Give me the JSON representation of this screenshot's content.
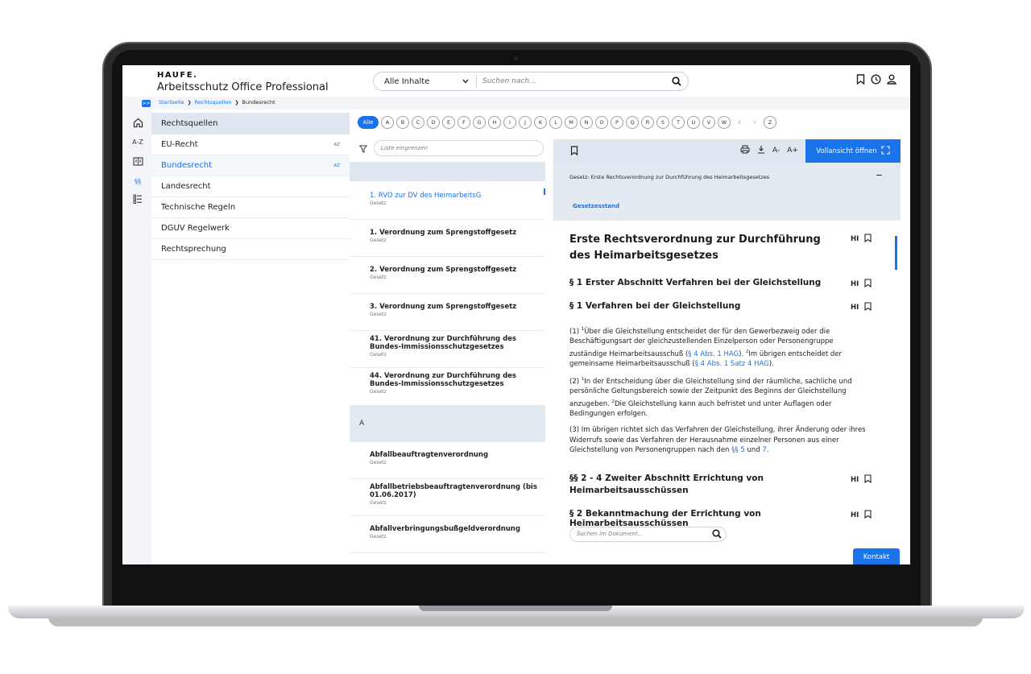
{
  "header": {
    "logo": "HAUFE.",
    "app_title": "Arbeitsschutz Office Professional",
    "scope": "Alle Inhalte",
    "search_placeholder": "Suchen nach..."
  },
  "breadcrumb": {
    "collapse_label": ">>",
    "items": [
      "Startseite",
      "Rechtsquellen",
      "Bundesrecht"
    ]
  },
  "rail": {
    "items": [
      {
        "icon": "home-icon"
      },
      {
        "label": "A-Z"
      },
      {
        "icon": "book-icon"
      },
      {
        "label": "§§"
      },
      {
        "icon": "list-icon"
      }
    ]
  },
  "sources": {
    "heading": "Rechtsquellen",
    "items": [
      {
        "label": "EU-Recht",
        "az": "AZ"
      },
      {
        "label": "Bundesrecht",
        "az": "AZ"
      },
      {
        "label": "Landesrecht",
        "az": ""
      },
      {
        "label": "Technische Regeln",
        "az": ""
      },
      {
        "label": "DGUV Regelwerk",
        "az": ""
      },
      {
        "label": "Rechtsprechung",
        "az": ""
      }
    ],
    "active_index": 1
  },
  "letters": {
    "all": "Alle",
    "items": [
      "A",
      "B",
      "C",
      "D",
      "E",
      "F",
      "G",
      "H",
      "I",
      "J",
      "K",
      "L",
      "M",
      "N",
      "O",
      "P",
      "Q",
      "R",
      "S",
      "T",
      "U",
      "V",
      "W",
      "X",
      "Y",
      "Z"
    ],
    "disabled": [
      "X",
      "Y"
    ]
  },
  "list": {
    "filter_placeholder": "Liste eingrenzen",
    "items": [
      {
        "title": "1. RVO zur DV des HeimarbeitsG",
        "type": "Gesetz"
      },
      {
        "title": "1. Verordnung zum Sprengstoffgesetz",
        "type": "Gesetz"
      },
      {
        "title": "2. Verordnung zum Sprengstoffgesetz",
        "type": "Gesetz"
      },
      {
        "title": "3. Verordnung zum Sprengstoffgesetz",
        "type": "Gesetz"
      },
      {
        "title": "41. Verordnung zur Durchführung des Bundes-Immissionsschutzgesetzes",
        "type": "Gesetz"
      },
      {
        "title": "44. Verordnung zur Durchführung des Bundes-Immissionsschutzgesetzes",
        "type": "Gesetz"
      },
      {
        "title": "Abfallbeauftragtenverordnung",
        "type": "Gesetz"
      },
      {
        "title": "Abfallbetriebsbeauftragtenverordnung (bis 01.06.2017)",
        "type": "Gesetz"
      },
      {
        "title": "Abfallverbringungsbußgeldverordnung",
        "type": "Gesetz"
      }
    ],
    "section_letter": "A"
  },
  "doc": {
    "toolbar": {
      "font_smaller": "A-",
      "font_larger": "A+",
      "fullview": "Vollansicht öffnen"
    },
    "law_title": "Gesetz: Erste Rechtsverordnung zur Durchführung des Heimarbeitsgesetzes",
    "law_collapse": "−",
    "law_status": "Gesetzesstand",
    "title": "Erste Rechtsverordnung zur Durchführung des Heimarbeitsgesetzes",
    "hl_label": "HI",
    "section1": "§ 1 Erster Abschnitt Verfahren bei der Gleichstellung",
    "section1b": "§ 1 Verfahren bei der Gleichstellung",
    "p1": {
      "a": "(1) ",
      "sup1": "1",
      "b": "Über die Gleichstellung entscheidet der für den Gewerbezweig oder die Beschäftigungsart der gleichzustellenden Einzelperson oder Personengruppe zuständige Heimarbeitsausschuß (",
      "link1": "§ 4 Abs. 1 HAG",
      "c": "). ",
      "sup2": "2",
      "d": "Im übrigen entscheidet der gemeinsame Heimarbeitsausschuß (",
      "link2": "§ 4 Abs. 1 Satz 4 HAG",
      "e": ")."
    },
    "p2": {
      "a": "(2) ",
      "sup1": "1",
      "b": "In der Entscheidung über die Gleichstellung sind der räumliche, sachliche und persönliche Geltungsbereich sowie der Zeitpunkt des Beginns der Gleichstellung anzugeben. ",
      "sup2": "2",
      "c": "Die Gleichstellung kann auch befristet und unter Auflagen oder Bedingungen erfolgen."
    },
    "p3": {
      "a": "(3) Im übrigen richtet sich das Verfahren der Gleichstellung, ihrer Änderung oder ihres Widerrufs sowie das Verfahren der Herausnahme einzelner Personen aus einer Gleichstellung von Personengruppen nach den ",
      "link1": "§§ 5",
      "b": " und ",
      "link2": "7",
      "c": "."
    },
    "section2": "§§ 2 - 4 Zweiter Abschnitt Errichtung von Heimarbeitsausschüssen",
    "section2b": "§ 2 Bekanntmachung der Errichtung von Heimarbeitsausschüssen",
    "search_placeholder": "Suchen im Dokument..."
  },
  "contact": "Kontakt",
  "colors": {
    "accent": "#1a73e8",
    "panel": "#dfe6ef",
    "rail": "#f3f5f8"
  }
}
